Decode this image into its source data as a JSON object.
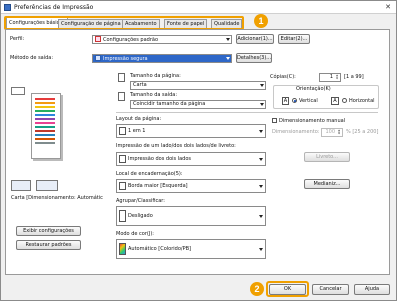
{
  "window": {
    "title": "Preferências de Impressão"
  },
  "tabs": [
    {
      "label": "Configurações básicas"
    },
    {
      "label": "Configuração de página"
    },
    {
      "label": "Acabamento"
    },
    {
      "label": "Fonte de papel"
    },
    {
      "label": "Qualidade"
    }
  ],
  "callouts": {
    "one": "1",
    "two": "2"
  },
  "profile": {
    "label": "Perfil:",
    "value": "Configurações padrão",
    "add_button": "Adicionar(1)...",
    "edit_button": "Editar(2)..."
  },
  "output": {
    "label": "Método de saída:",
    "value": "Impressão segura",
    "details_button": "Detalhes(3)..."
  },
  "preview": {
    "caption": "Carta [Dimensionamento: Automátic",
    "view_settings_button": "Exibir configurações",
    "restore_button": "Restaurar padrões"
  },
  "page_size": {
    "label": "Tamanho da página:",
    "value": "Carta"
  },
  "output_size": {
    "label": "Tamanho da saída:",
    "value": "Coincidir tamanho da página"
  },
  "copies": {
    "label": "Cópias(C):",
    "value": "1",
    "range": "[1 a 99]"
  },
  "orientation": {
    "label": "Orientação(K)",
    "portrait": "Vertical",
    "landscape": "Horizontal"
  },
  "layout": {
    "label": "Layout da página:",
    "value": "1 em 1"
  },
  "manual_scaling": {
    "label": "Dimensionamento manual",
    "field_label": "Dimensionamento:",
    "value": "100",
    "range": "% [25 a 200]"
  },
  "duplex": {
    "label": "Impressão de um lado/dos dois lados/de livreto:",
    "value": "Impressão dos dois lados",
    "booklet_button": "Livreto..."
  },
  "binding": {
    "label": "Local de encadernação(5):",
    "value": "Borda maior [Esquerda]",
    "margin_button": "Medianiz..."
  },
  "collate": {
    "label": "Agrupar/Classificar:",
    "value": "Desligado"
  },
  "color_mode": {
    "label": "Modo de cor(J):",
    "value": "Automático [Colorido/PB]"
  },
  "footer": {
    "ok": "OK",
    "cancel": "Cancelar",
    "help": "Ajuda"
  }
}
